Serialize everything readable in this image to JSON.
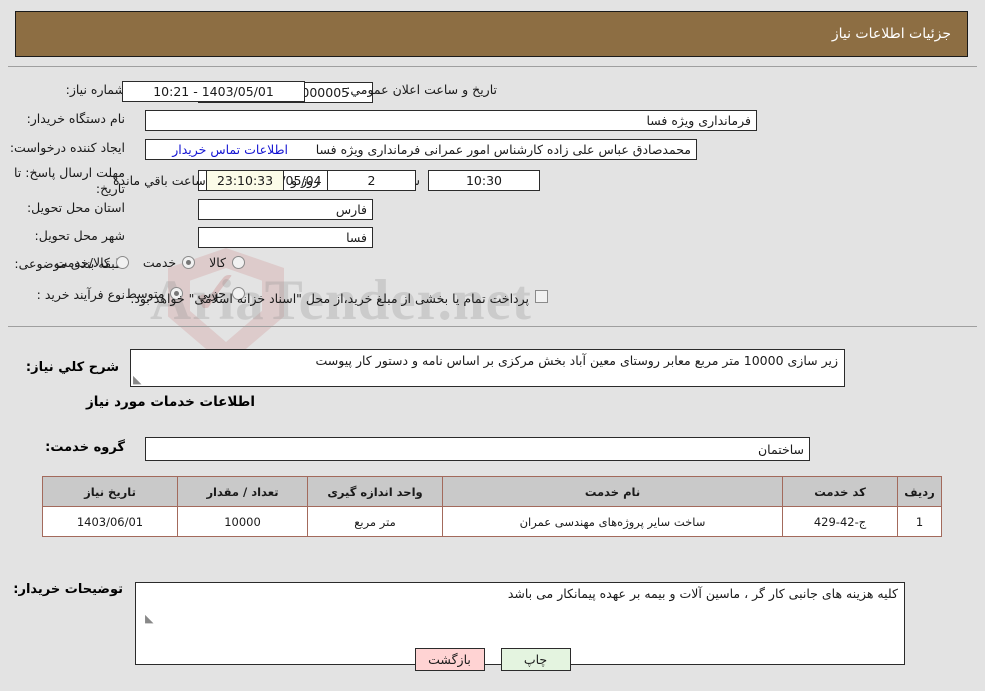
{
  "header": {
    "title": "جزئیات اطلاعات نیاز"
  },
  "form": {
    "need_number_label": "شماره نیاز:",
    "need_number_value": "1103003675000005",
    "buyer_org_label": "نام دستگاه خریدار:",
    "buyer_org_value": "فرمانداری ویژه فسا",
    "creator_label": "ایجاد کننده درخواست:",
    "creator_value": "محمدصادق عباس علی زاده کارشناس امور عمرانی فرمانداری ویژه فسا",
    "contact_link": "اطلاعات تماس خریدار",
    "deadline_label": "مهلت ارسال پاسخ: تا تاریخ:",
    "deadline_date": "1403/05/04",
    "deadline_hour_label": "ساعت",
    "deadline_hour_value": "10:30",
    "days_value": "2",
    "days_label": "روز و",
    "timer_value": "23:10:33",
    "timer_label": "ساعت باقي مانده",
    "announce_label": "تاریخ و ساعت اعلان عمومي:",
    "announce_value": "1403/05/01 - 10:21",
    "province_label": "استان محل تحویل:",
    "province_value": "فارس",
    "city_label": "شهر محل تحویل:",
    "city_value": "فسا",
    "category_label": "طبقه بندی موضوعی:",
    "category_options": [
      {
        "label": "کالا",
        "selected": false
      },
      {
        "label": "خدمت",
        "selected": true
      },
      {
        "label": "کالا/خدمت",
        "selected": false
      }
    ],
    "purchase_type_label": "نوع فرآیند خرید :",
    "purchase_type_options": [
      {
        "label": "جزیي",
        "selected": false
      },
      {
        "label": "متوسط",
        "selected": true
      }
    ],
    "treasury_checkbox_checked": false,
    "treasury_note": "پرداخت تمام یا بخشی از مبلغ خرید،از محل \"اسناد خزانه اسلامی\" خواهد بود."
  },
  "description": {
    "label": "شرح کلي نیاز:",
    "value": "زیر سازی 10000 متر مربع معابر روستای معین آباد بخش مرکزی بر اساس نامه و دستور کار پیوست"
  },
  "services_section": {
    "heading": "اطلاعات خدمات مورد نیاز",
    "group_label": "گروه خدمت:",
    "group_value": "ساختمان"
  },
  "table": {
    "headers": [
      "ردیف",
      "کد خدمت",
      "نام خدمت",
      "واحد اندازه گیری",
      "تعداد / مقدار",
      "تاریخ نیاز"
    ],
    "rows": [
      {
        "row_no": "1",
        "service_code": "ج-42-429",
        "service_name": "ساخت سایر پروژه‌های مهندسی عمران",
        "unit": "متر مربع",
        "quantity": "10000",
        "need_date": "1403/06/01"
      }
    ]
  },
  "buyer_notes": {
    "label": "توضیحات خریدار:",
    "value": "کلیه هزینه های جانبی کار گر ، ماسین آلات و بیمه بر عهده پیمانکار می باشد"
  },
  "buttons": {
    "back": "بازگشت",
    "print": "چاپ"
  },
  "watermark": {
    "text": "AriaTender.net"
  },
  "colors": {
    "header_brown": "#8d6e43",
    "link_blue": "#1414d2",
    "timer_bg": "#fbfbe8",
    "table_border": "#a36a5c",
    "table_header_bg": "#c9c9c9",
    "btn_back_bg": "#ffd3d3",
    "btn_print_bg": "#e4f4e0",
    "page_bg": "#e3e3e3"
  }
}
